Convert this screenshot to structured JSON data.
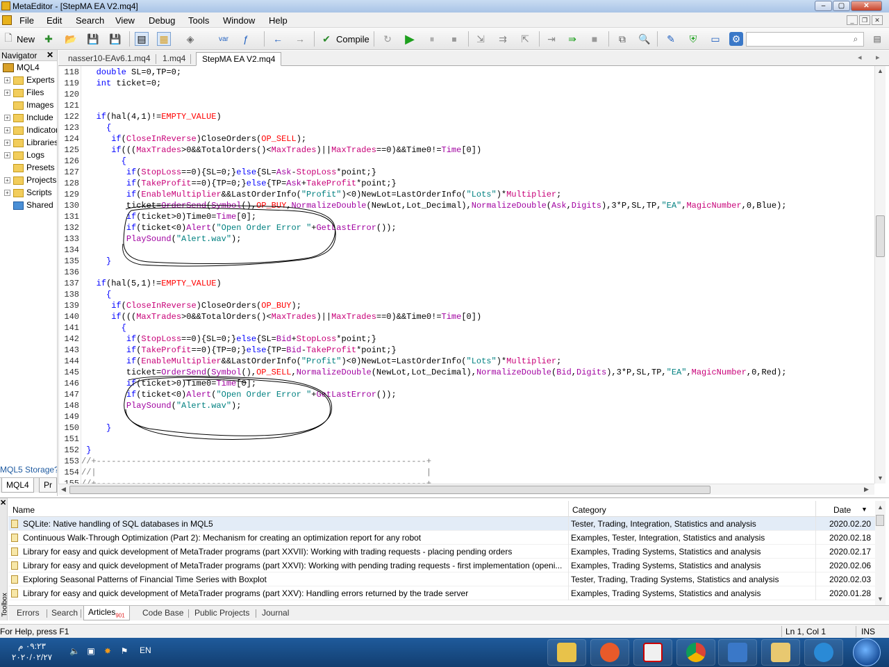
{
  "window": {
    "title": "MetaEditor - [StepMA EA V2.mq4]",
    "controls": {
      "minimize": "‒",
      "maximize": "▢",
      "close": "✕"
    }
  },
  "menu": {
    "items": [
      "File",
      "Edit",
      "Search",
      "View",
      "Debug",
      "Tools",
      "Window",
      "Help"
    ]
  },
  "toolbar": {
    "new_label": "New",
    "compile_label": "Compile",
    "var_label": "var",
    "search_placeholder": ""
  },
  "navigator": {
    "title": "Navigator",
    "root": "MQL4",
    "items": [
      {
        "label": "Experts",
        "expandable": true,
        "color": "yellow"
      },
      {
        "label": "Files",
        "expandable": true,
        "color": "yellow"
      },
      {
        "label": "Images",
        "expandable": false,
        "color": "yellow"
      },
      {
        "label": "Include",
        "expandable": true,
        "color": "yellow"
      },
      {
        "label": "Indicators",
        "expandable": true,
        "color": "yellow"
      },
      {
        "label": "Libraries",
        "expandable": true,
        "color": "yellow"
      },
      {
        "label": "Logs",
        "expandable": true,
        "color": "yellow"
      },
      {
        "label": "Presets",
        "expandable": false,
        "color": "yellow"
      },
      {
        "label": "Projects",
        "expandable": true,
        "color": "yellow"
      },
      {
        "label": "Scripts",
        "expandable": true,
        "color": "yellow"
      },
      {
        "label": "Shared",
        "expandable": false,
        "color": "blue"
      }
    ],
    "storage_link": "MQL5 Storage?",
    "tabs": [
      "MQL4",
      "Pr"
    ]
  },
  "doc_tabs": [
    "nasser10-EAv6.1.mq4",
    "1.mq4",
    "StepMA EA V2.mq4"
  ],
  "editor": {
    "lines": [
      {
        "n": "118",
        "tokens": [
          [
            "   ",
            ""
          ],
          [
            "double",
            "kw"
          ],
          [
            " SL=0,TP=0;",
            ""
          ]
        ]
      },
      {
        "n": "119",
        "tokens": [
          [
            "   ",
            ""
          ],
          [
            "int",
            "kw"
          ],
          [
            " ticket=0;",
            ""
          ]
        ]
      },
      {
        "n": "120",
        "tokens": []
      },
      {
        "n": "121",
        "tokens": []
      },
      {
        "n": "122",
        "tokens": [
          [
            "   ",
            ""
          ],
          [
            "if",
            "kw"
          ],
          [
            "(hal(4,1)!=",
            ""
          ],
          [
            "EMPTY_VALUE",
            "const"
          ],
          [
            ")",
            ""
          ]
        ]
      },
      {
        "n": "123",
        "tokens": [
          [
            "     {",
            "kw"
          ]
        ]
      },
      {
        "n": "124",
        "tokens": [
          [
            "      ",
            ""
          ],
          [
            "if",
            "kw"
          ],
          [
            "(",
            ""
          ],
          [
            "CloseInReverse",
            "var"
          ],
          [
            ")CloseOrders(",
            ""
          ],
          [
            "OP_SELL",
            "const"
          ],
          [
            ");",
            ""
          ]
        ]
      },
      {
        "n": "125",
        "tokens": [
          [
            "      ",
            ""
          ],
          [
            "if",
            "kw"
          ],
          [
            "(((",
            ""
          ],
          [
            "MaxTrades",
            "var"
          ],
          [
            ">0&&TotalOrders()<",
            ""
          ],
          [
            "MaxTrades",
            "var"
          ],
          [
            ")||",
            ""
          ],
          [
            "MaxTrades",
            "var"
          ],
          [
            "==0)&&Time0!=",
            ""
          ],
          [
            "Time",
            "func"
          ],
          [
            "[0])",
            ""
          ]
        ]
      },
      {
        "n": "126",
        "tokens": [
          [
            "        {",
            "kw"
          ]
        ]
      },
      {
        "n": "127",
        "tokens": [
          [
            "         ",
            ""
          ],
          [
            "if",
            "kw"
          ],
          [
            "(",
            ""
          ],
          [
            "StopLoss",
            "var"
          ],
          [
            "==0){SL=0;}",
            ""
          ],
          [
            "else",
            "kw"
          ],
          [
            "{SL=",
            ""
          ],
          [
            "Ask",
            "func"
          ],
          [
            "-",
            ""
          ],
          [
            "StopLoss",
            "var"
          ],
          [
            "*point;}",
            ""
          ]
        ]
      },
      {
        "n": "128",
        "tokens": [
          [
            "         ",
            ""
          ],
          [
            "if",
            "kw"
          ],
          [
            "(",
            ""
          ],
          [
            "TakeProfit",
            "var"
          ],
          [
            "==0){TP=0;}",
            ""
          ],
          [
            "else",
            "kw"
          ],
          [
            "{TP=",
            ""
          ],
          [
            "Ask",
            "func"
          ],
          [
            "+",
            ""
          ],
          [
            "TakeProfit",
            "var"
          ],
          [
            "*point;}",
            ""
          ]
        ]
      },
      {
        "n": "129",
        "tokens": [
          [
            "         ",
            ""
          ],
          [
            "if",
            "kw"
          ],
          [
            "(",
            ""
          ],
          [
            "EnableMultiplier",
            "var"
          ],
          [
            "&&LastOrderInfo(",
            ""
          ],
          [
            "\"Profit\"",
            "str"
          ],
          [
            ")<0)NewLot=LastOrderInfo(",
            ""
          ],
          [
            "\"Lots\"",
            "str"
          ],
          [
            ")*",
            ""
          ],
          [
            "Multiplier",
            "var"
          ],
          [
            ";",
            ""
          ]
        ]
      },
      {
        "n": "130",
        "tokens": [
          [
            "         ticket=",
            ""
          ],
          [
            "OrderSend",
            "func"
          ],
          [
            "(",
            ""
          ],
          [
            "Symbol",
            "func"
          ],
          [
            "(),",
            ""
          ],
          [
            "OP_BUY",
            "const"
          ],
          [
            ",",
            ""
          ],
          [
            "NormalizeDouble",
            "func"
          ],
          [
            "(NewLot,Lot_Decimal),",
            ""
          ],
          [
            "NormalizeDouble",
            "func"
          ],
          [
            "(",
            ""
          ],
          [
            "Ask",
            "func"
          ],
          [
            ",",
            ""
          ],
          [
            "Digits",
            "func"
          ],
          [
            "),3*P,SL,TP,",
            ""
          ],
          [
            "\"EA\"",
            "str"
          ],
          [
            ",",
            ""
          ],
          [
            "MagicNumber",
            "var"
          ],
          [
            ",0,Blue);",
            ""
          ]
        ]
      },
      {
        "n": "131",
        "tokens": [
          [
            "         ",
            ""
          ],
          [
            "if",
            "kw"
          ],
          [
            "(ticket>0)Time0=",
            ""
          ],
          [
            "Time",
            "func"
          ],
          [
            "[0];",
            ""
          ]
        ]
      },
      {
        "n": "132",
        "tokens": [
          [
            "         ",
            ""
          ],
          [
            "if",
            "kw"
          ],
          [
            "(ticket<0)",
            ""
          ],
          [
            "Alert",
            "func"
          ],
          [
            "(",
            ""
          ],
          [
            "\"Open Order Error \"",
            "str"
          ],
          [
            "+",
            ""
          ],
          [
            "GetLastError",
            "func"
          ],
          [
            "());",
            ""
          ]
        ]
      },
      {
        "n": "133",
        "tokens": [
          [
            "         ",
            ""
          ],
          [
            "PlaySound",
            "func"
          ],
          [
            "(",
            ""
          ],
          [
            "\"Alert.wav\"",
            "str"
          ],
          [
            ");",
            ""
          ]
        ]
      },
      {
        "n": "134",
        "tokens": []
      },
      {
        "n": "135",
        "tokens": [
          [
            "     }",
            "kw"
          ]
        ]
      },
      {
        "n": "136",
        "tokens": []
      },
      {
        "n": "137",
        "tokens": [
          [
            "   ",
            ""
          ],
          [
            "if",
            "kw"
          ],
          [
            "(hal(5,1)!=",
            ""
          ],
          [
            "EMPTY_VALUE",
            "const"
          ],
          [
            ")",
            ""
          ]
        ]
      },
      {
        "n": "138",
        "tokens": [
          [
            "     {",
            "kw"
          ]
        ]
      },
      {
        "n": "139",
        "tokens": [
          [
            "      ",
            ""
          ],
          [
            "if",
            "kw"
          ],
          [
            "(",
            ""
          ],
          [
            "CloseInReverse",
            "var"
          ],
          [
            ")CloseOrders(",
            ""
          ],
          [
            "OP_BUY",
            "const"
          ],
          [
            ");",
            ""
          ]
        ]
      },
      {
        "n": "140",
        "tokens": [
          [
            "      ",
            ""
          ],
          [
            "if",
            "kw"
          ],
          [
            "(((",
            ""
          ],
          [
            "MaxTrades",
            "var"
          ],
          [
            ">0&&TotalOrders()<",
            ""
          ],
          [
            "MaxTrades",
            "var"
          ],
          [
            ")||",
            ""
          ],
          [
            "MaxTrades",
            "var"
          ],
          [
            "==0)&&Time0!=",
            ""
          ],
          [
            "Time",
            "func"
          ],
          [
            "[0])",
            ""
          ]
        ]
      },
      {
        "n": "141",
        "tokens": [
          [
            "        {",
            "kw"
          ]
        ]
      },
      {
        "n": "142",
        "tokens": [
          [
            "         ",
            ""
          ],
          [
            "if",
            "kw"
          ],
          [
            "(",
            ""
          ],
          [
            "StopLoss",
            "var"
          ],
          [
            "==0){SL=0;}",
            ""
          ],
          [
            "else",
            "kw"
          ],
          [
            "{SL=",
            ""
          ],
          [
            "Bid",
            "func"
          ],
          [
            "+",
            ""
          ],
          [
            "StopLoss",
            "var"
          ],
          [
            "*point;}",
            ""
          ]
        ]
      },
      {
        "n": "143",
        "tokens": [
          [
            "         ",
            ""
          ],
          [
            "if",
            "kw"
          ],
          [
            "(",
            ""
          ],
          [
            "TakeProfit",
            "var"
          ],
          [
            "==0){TP=0;}",
            ""
          ],
          [
            "else",
            "kw"
          ],
          [
            "{TP=",
            ""
          ],
          [
            "Bid",
            "func"
          ],
          [
            "-",
            ""
          ],
          [
            "TakeProfit",
            "var"
          ],
          [
            "*point;}",
            ""
          ]
        ]
      },
      {
        "n": "144",
        "tokens": [
          [
            "         ",
            ""
          ],
          [
            "if",
            "kw"
          ],
          [
            "(",
            ""
          ],
          [
            "EnableMultiplier",
            "var"
          ],
          [
            "&&LastOrderInfo(",
            ""
          ],
          [
            "\"Profit\"",
            "str"
          ],
          [
            ")<0)NewLot=LastOrderInfo(",
            ""
          ],
          [
            "\"Lots\"",
            "str"
          ],
          [
            ")*",
            ""
          ],
          [
            "Multiplier",
            "var"
          ],
          [
            ";",
            ""
          ]
        ]
      },
      {
        "n": "145",
        "tokens": [
          [
            "         ticket=",
            ""
          ],
          [
            "OrderSend",
            "func"
          ],
          [
            "(",
            ""
          ],
          [
            "Symbol",
            "func"
          ],
          [
            "(),",
            ""
          ],
          [
            "OP_SELL",
            "const"
          ],
          [
            ",",
            ""
          ],
          [
            "NormalizeDouble",
            "func"
          ],
          [
            "(NewLot,Lot_Decimal),",
            ""
          ],
          [
            "NormalizeDouble",
            "func"
          ],
          [
            "(",
            ""
          ],
          [
            "Bid",
            "func"
          ],
          [
            ",",
            ""
          ],
          [
            "Digits",
            "func"
          ],
          [
            "),3*P,SL,TP,",
            ""
          ],
          [
            "\"EA\"",
            "str"
          ],
          [
            ",",
            ""
          ],
          [
            "MagicNumber",
            "var"
          ],
          [
            ",0,Red);",
            ""
          ]
        ]
      },
      {
        "n": "146",
        "tokens": [
          [
            "         ",
            ""
          ],
          [
            "if",
            "kw"
          ],
          [
            "(ticket>0)Time0=",
            ""
          ],
          [
            "Time",
            "func"
          ],
          [
            "[0];",
            ""
          ]
        ]
      },
      {
        "n": "147",
        "tokens": [
          [
            "         ",
            ""
          ],
          [
            "if",
            "kw"
          ],
          [
            "(ticket<0)",
            ""
          ],
          [
            "Alert",
            "func"
          ],
          [
            "(",
            ""
          ],
          [
            "\"Open Order Error \"",
            "str"
          ],
          [
            "+",
            ""
          ],
          [
            "GetLastError",
            "func"
          ],
          [
            "());",
            ""
          ]
        ]
      },
      {
        "n": "148",
        "tokens": [
          [
            "         ",
            ""
          ],
          [
            "PlaySound",
            "func"
          ],
          [
            "(",
            ""
          ],
          [
            "\"Alert.wav\"",
            "str"
          ],
          [
            ");",
            ""
          ]
        ]
      },
      {
        "n": "149",
        "tokens": []
      },
      {
        "n": "150",
        "tokens": [
          [
            "     }",
            "kw"
          ]
        ]
      },
      {
        "n": "151",
        "tokens": []
      },
      {
        "n": "152",
        "tokens": [
          [
            " }",
            "kw"
          ]
        ]
      },
      {
        "n": "153",
        "tokens": [
          [
            "//+------------------------------------------------------------------+",
            "cmt"
          ]
        ]
      },
      {
        "n": "154",
        "tokens": [
          [
            "//|                                                                  |",
            "cmt"
          ]
        ]
      },
      {
        "n": "155",
        "tokens": [
          [
            "//+------------------------------------------------------------------+",
            "cmt"
          ]
        ]
      }
    ]
  },
  "articles": {
    "columns": {
      "name": "Name",
      "category": "Category",
      "date": "Date"
    },
    "rows": [
      {
        "name": "SQLite: Native handling of SQL databases in MQL5",
        "category": "Tester, Trading, Integration, Statistics and analysis",
        "date": "2020.02.20",
        "selected": true
      },
      {
        "name": "Continuous Walk-Through Optimization (Part 2): Mechanism for creating an optimization report for any robot",
        "category": "Examples, Tester, Integration, Statistics and analysis",
        "date": "2020.02.18",
        "selected": false
      },
      {
        "name": "Library for easy and quick development of MetaTrader programs (part XXVII): Working with trading requests - placing pending orders",
        "category": "Examples, Trading Systems, Statistics and analysis",
        "date": "2020.02.17",
        "selected": false
      },
      {
        "name": "Library for easy and quick development of MetaTrader programs (part XXVI): Working with pending trading requests - first implementation (openi...",
        "category": "Examples, Trading Systems, Statistics and analysis",
        "date": "2020.02.06",
        "selected": false
      },
      {
        "name": "Exploring Seasonal Patterns of Financial Time Series with Boxplot",
        "category": "Tester, Trading, Trading Systems, Statistics and analysis",
        "date": "2020.02.03",
        "selected": false
      },
      {
        "name": "Library for easy and quick development of MetaTrader programs (part XXV): Handling errors returned by the trade server",
        "category": "Examples, Trading Systems, Statistics and analysis",
        "date": "2020.01.28",
        "selected": false
      }
    ]
  },
  "toolbox": {
    "side_label": "Toolbox",
    "tabs": [
      "Errors",
      "Search",
      "Articles",
      "Code Base",
      "Public Projects",
      "Journal"
    ],
    "articles_count": "901",
    "active_tab": "Articles"
  },
  "status": {
    "help": "For Help, press F1",
    "position": "Ln 1, Col 1",
    "mode": "INS"
  },
  "taskbar": {
    "time": "٠٩:٢٣ م",
    "date": "٢٠٢٠/٠٢/٢٧",
    "language": "EN"
  },
  "colors": {
    "keyword": "#0000ff",
    "constant": "#ff0000",
    "function": "#a000a0",
    "variable": "#c80078",
    "string": "#008080",
    "comment": "#808080"
  }
}
